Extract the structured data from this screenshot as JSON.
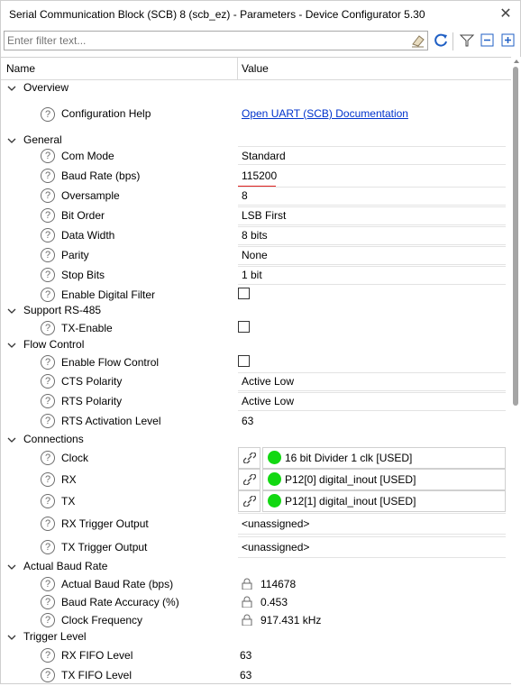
{
  "window": {
    "title": "Serial Communication Block (SCB) 8 (scb_ez) - Parameters - Device Configurator 5.30",
    "close_glyph": "✕"
  },
  "toolbar": {
    "filter_placeholder": "Enter filter text...",
    "icons": [
      "eraser-icon",
      "refresh-icon",
      "filter-icon",
      "collapse-all-icon",
      "expand-all-icon"
    ]
  },
  "grid": {
    "headers": {
      "name": "Name",
      "value": "Value"
    },
    "help_glyph": "?",
    "categories": {
      "overview": "Overview",
      "general": "General",
      "rs485": "Support RS-485",
      "flow": "Flow Control",
      "connections": "Connections",
      "baud": "Actual Baud Rate",
      "trigger": "Trigger Level"
    },
    "overview": {
      "config_help": {
        "name": "Configuration Help",
        "value": "Open UART (SCB) Documentation"
      }
    },
    "general": {
      "com_mode": {
        "name": "Com Mode",
        "value": "Standard"
      },
      "baud_rate": {
        "name": "Baud Rate (bps)",
        "value": "115200"
      },
      "oversample": {
        "name": "Oversample",
        "value": "8"
      },
      "bit_order": {
        "name": "Bit Order",
        "value": "LSB First"
      },
      "data_width": {
        "name": "Data Width",
        "value": "8 bits"
      },
      "parity": {
        "name": "Parity",
        "value": "None"
      },
      "stop_bits": {
        "name": "Stop Bits",
        "value": "1 bit"
      },
      "digital_filter": {
        "name": "Enable Digital Filter",
        "checked": false
      }
    },
    "rs485": {
      "tx_enable": {
        "name": "TX-Enable",
        "checked": false
      }
    },
    "flow": {
      "enable": {
        "name": "Enable Flow Control",
        "checked": false
      },
      "cts": {
        "name": "CTS Polarity",
        "value": "Active Low"
      },
      "rts": {
        "name": "RTS Polarity",
        "value": "Active Low"
      },
      "rts_level": {
        "name": "RTS Activation Level",
        "value": "63"
      }
    },
    "connections": {
      "clock": {
        "name": "Clock",
        "value": "16 bit Divider 1 clk [USED]"
      },
      "rx": {
        "name": "RX",
        "value": "P12[0] digital_inout [USED]"
      },
      "tx": {
        "name": "TX",
        "value": "P12[1] digital_inout [USED]"
      },
      "rx_trigger": {
        "name": "RX Trigger Output",
        "value": "<unassigned>"
      },
      "tx_trigger": {
        "name": "TX Trigger Output",
        "value": "<unassigned>"
      }
    },
    "baud": {
      "actual": {
        "name": "Actual Baud Rate (bps)",
        "value": "114678"
      },
      "accuracy": {
        "name": "Baud Rate Accuracy (%)",
        "value": "0.453"
      },
      "clock_freq": {
        "name": "Clock Frequency",
        "value": "917.431 kHz"
      }
    },
    "trigger": {
      "rx_fifo": {
        "name": "RX FIFO Level",
        "value": "63"
      },
      "tx_fifo": {
        "name": "TX FIFO Level",
        "value": "63"
      }
    }
  },
  "colors": {
    "used_indicator": "#12d812",
    "link": "#0033cc",
    "underline_marker": "#e0201f"
  }
}
